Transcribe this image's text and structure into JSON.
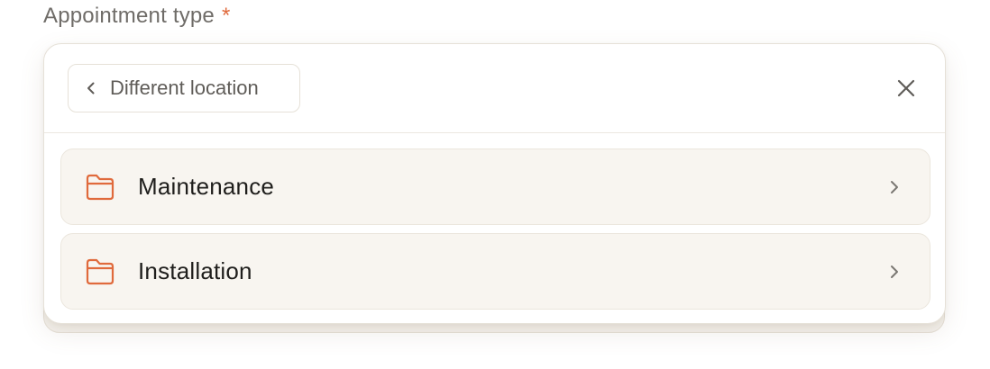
{
  "field": {
    "label": "Appointment type",
    "required_mark": "*"
  },
  "panel": {
    "back_label": "Different location",
    "back_icon": "chevron-left-icon",
    "close_icon": "close-icon",
    "items": [
      {
        "label": "Maintenance",
        "icon": "folder-icon",
        "trailing_icon": "chevron-right-icon"
      },
      {
        "label": "Installation",
        "icon": "folder-icon",
        "trailing_icon": "chevron-right-icon"
      }
    ]
  },
  "colors": {
    "accent": "#e06a3c",
    "label_text": "#6f6c68",
    "item_bg": "#f8f5f0",
    "border": "#e6e1d8"
  }
}
